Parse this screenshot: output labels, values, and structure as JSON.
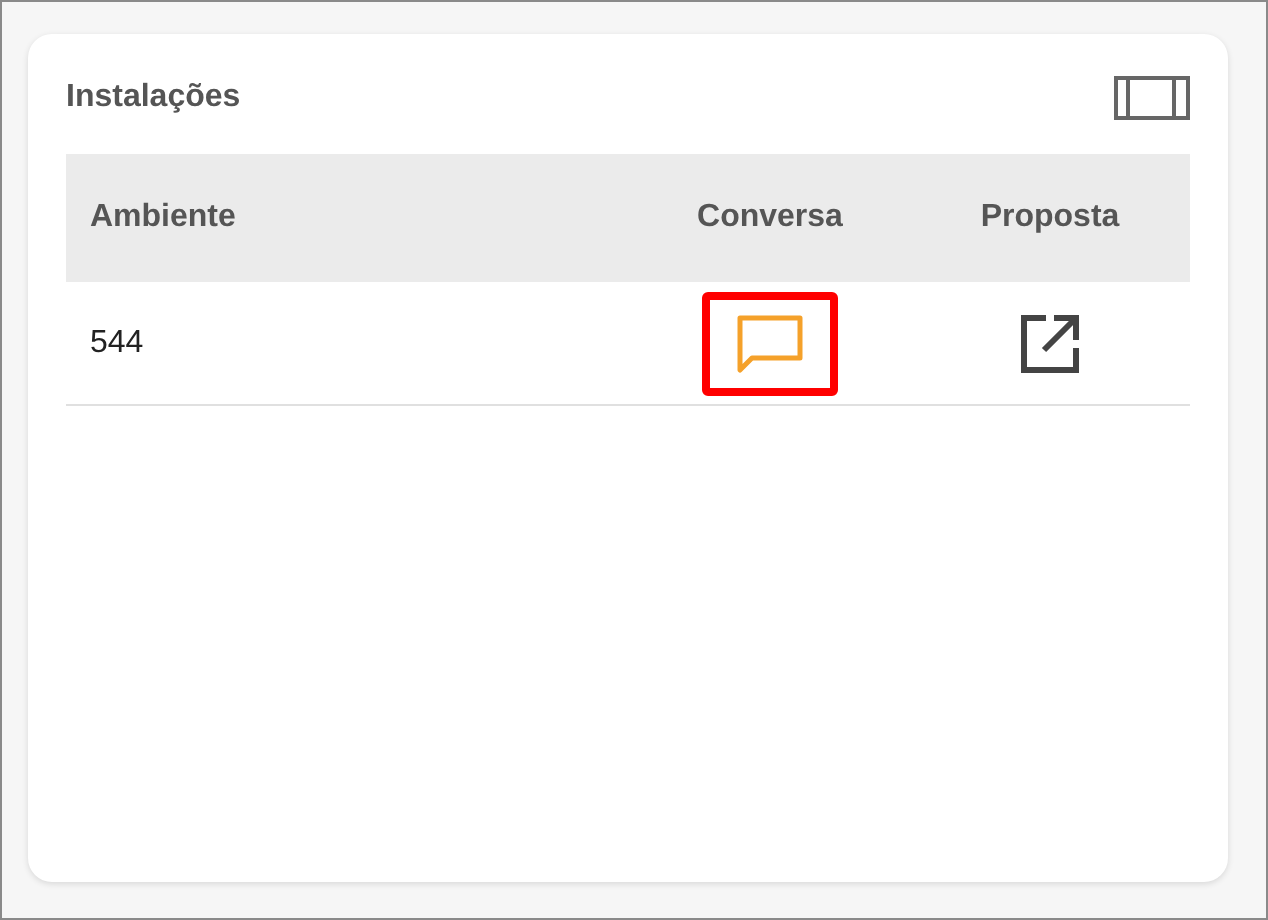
{
  "card": {
    "title": "Instalações"
  },
  "table": {
    "columns": [
      "Ambiente",
      "Conversa",
      "Proposta"
    ],
    "rows": [
      {
        "ambiente": "544",
        "conversa_highlighted": true
      }
    ]
  }
}
